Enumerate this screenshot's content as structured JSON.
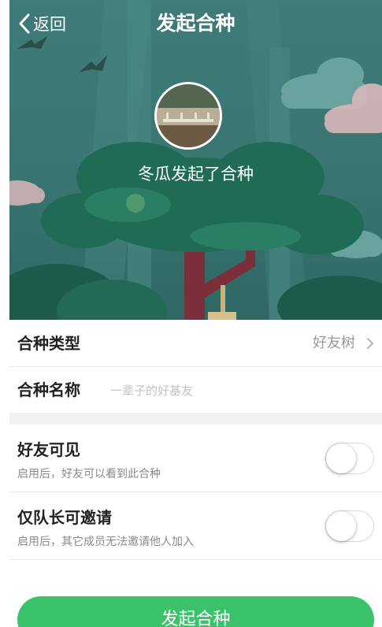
{
  "header": {
    "back_label": "返回",
    "title": "发起合种"
  },
  "hero": {
    "caption": "冬瓜发起了合种"
  },
  "form": {
    "type_row": {
      "label": "合种类型",
      "value": "好友树"
    },
    "name_row": {
      "label": "合种名称",
      "placeholder": "一辈子的好基友",
      "value": ""
    },
    "friend_visible": {
      "title": "好友可见",
      "desc": "启用后，好友可以看到此合种",
      "enabled": false
    },
    "captain_invite_only": {
      "title": "仅队长可邀请",
      "desc": "启用后，其它成员无法邀请他人加入",
      "enabled": false
    }
  },
  "submit_label": "发起合种",
  "colors": {
    "accent": "#3ac36a",
    "hero_bg": "#3f7b78"
  }
}
